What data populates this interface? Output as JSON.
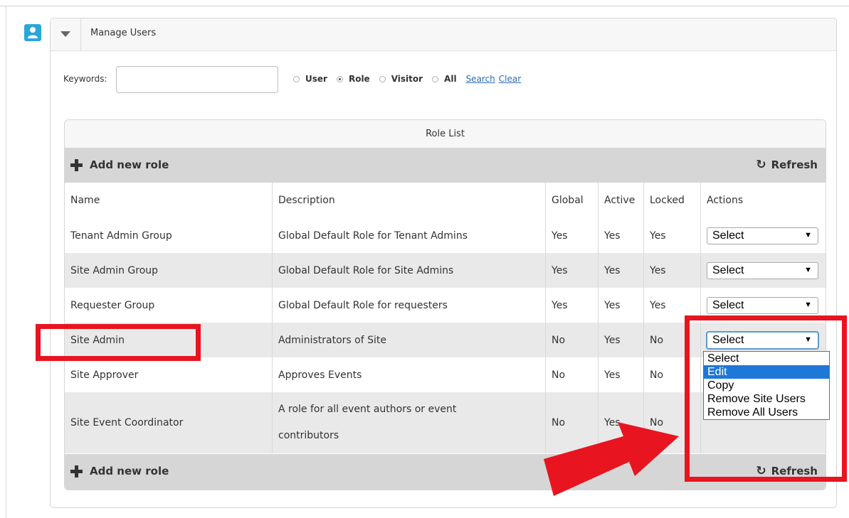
{
  "panel": {
    "title": "Manage Users"
  },
  "search": {
    "keywords_label": "Keywords:",
    "keywords_value": "",
    "radios": [
      {
        "label": "User",
        "selected": false
      },
      {
        "label": "Role",
        "selected": true
      },
      {
        "label": "Visitor",
        "selected": false
      },
      {
        "label": "All",
        "selected": false
      }
    ],
    "search_link": "Search",
    "clear_link": "Clear"
  },
  "role_list": {
    "title": "Role List",
    "add_new_label": "Add new role",
    "refresh_label": "Refresh",
    "columns": [
      "Name",
      "Description",
      "Global",
      "Active",
      "Locked",
      "Actions"
    ],
    "rows": [
      {
        "name": "Tenant Admin Group",
        "description": "Global Default Role for Tenant Admins",
        "global": "Yes",
        "active": "Yes",
        "locked": "Yes",
        "action": "Select"
      },
      {
        "name": "Site Admin Group",
        "description": "Global Default Role for Site Admins",
        "global": "Yes",
        "active": "Yes",
        "locked": "Yes",
        "action": "Select"
      },
      {
        "name": "Requester Group",
        "description": "Global Default Role for requesters",
        "global": "Yes",
        "active": "Yes",
        "locked": "Yes",
        "action": "Select"
      },
      {
        "name": "Site Admin",
        "description": "Administrators of Site",
        "global": "No",
        "active": "Yes",
        "locked": "No",
        "action": "Select"
      },
      {
        "name": "Site Approver",
        "description": "Approves Events",
        "global": "No",
        "active": "Yes",
        "locked": "No",
        "action": ""
      },
      {
        "name": "Site Event Coordinator",
        "description_line1": "A role for all event authors or event",
        "description_line2": "contributors",
        "global": "No",
        "active": "Yes",
        "locked": "No",
        "action": ""
      }
    ],
    "dropdown_options": [
      "Select",
      "Edit",
      "Copy",
      "Remove Site Users",
      "Remove All Users"
    ],
    "dropdown_highlighted": "Edit"
  },
  "colors": {
    "badge": "#2aa6d8",
    "toolbar_bg": "#d6d6d6",
    "alt_row_bg": "#e9e9e9",
    "link": "#2a6fb5",
    "highlight_option": "#1e78d7",
    "annotation_red": "#e8141f"
  },
  "icons": {
    "badge": "user-icon",
    "collapse": "caret-down-icon",
    "add": "plus-icon",
    "refresh": "refresh-icon",
    "select_caret": "triangle-down-icon"
  }
}
